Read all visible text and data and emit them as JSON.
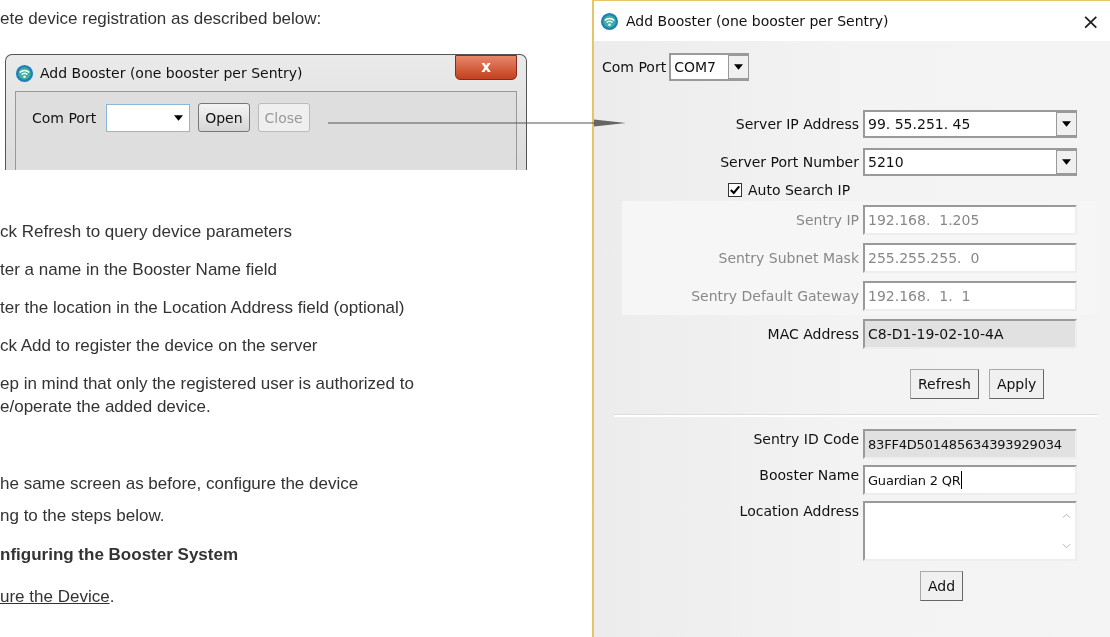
{
  "document": {
    "intro": "ete device registration as described below:",
    "steps": [
      "ck Refresh to query device parameters",
      "ter a name in the Booster Name field",
      "ter the location in the Location Address field (optional)",
      "ck Add to register the device on the server",
      "ep in mind that only the registered user is authorized to\ne/operate the added device."
    ],
    "paragraph": "he same screen as before, configure the device\nng to the steps below.",
    "heading": "nfiguring the Booster System",
    "link": "ure the Device",
    "link_suffix": "."
  },
  "small_dialog": {
    "title": "Add Booster (one booster per Sentry)",
    "close_glyph": "x",
    "com_port_label": "Com Port",
    "buttons": [
      {
        "label": "Open",
        "disabled": false
      },
      {
        "label": "Close",
        "disabled": true
      }
    ]
  },
  "dialog": {
    "title": "Add Booster (one booster per Sentry)",
    "close_glyph": "×",
    "com_port_label": "Com Port",
    "com_port_value": "COM7",
    "server_fields": [
      {
        "label": "Server IP Address",
        "value": "99. 55.251. 45",
        "kind": "combo"
      },
      {
        "label": "Server Port Number",
        "value": "5210",
        "kind": "combo"
      }
    ],
    "auto_search": {
      "label": "Auto Search IP",
      "checked": true
    },
    "network_fields": [
      {
        "label": "Sentry IP",
        "value": "192.168.  1.205",
        "kind": "text",
        "disabled": true
      },
      {
        "label": "Sentry Subnet Mask",
        "value": "255.255.255.  0",
        "kind": "text",
        "disabled": true
      },
      {
        "label": "Sentry Default Gateway",
        "value": "192.168.  1.  1",
        "kind": "text",
        "disabled": true
      },
      {
        "label": "MAC Address",
        "value": "C8-D1-19-02-10-4A",
        "kind": "readonly",
        "disabled": false
      }
    ],
    "buttons": [
      "Refresh",
      "Apply"
    ],
    "booster_fields": [
      {
        "label": "Sentry ID Code",
        "value": "83FF4D501485634393929034",
        "kind": "readonly"
      },
      {
        "label": "Booster Name",
        "value": "Guardian 2 QR",
        "kind": "text"
      },
      {
        "label": "Location Address",
        "kind": "textarea"
      }
    ],
    "add_button": "Add"
  }
}
